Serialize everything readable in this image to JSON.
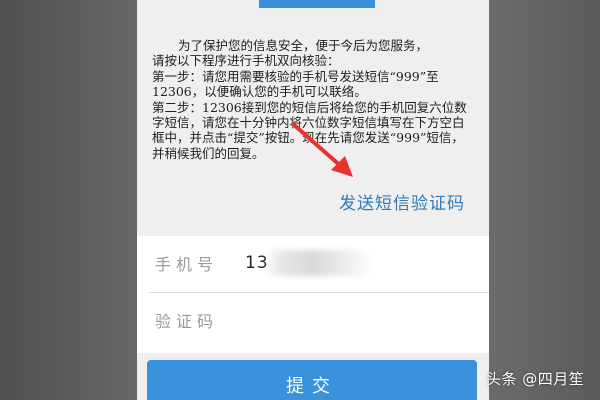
{
  "notice": {
    "lines": [
      "为了保护您的信息安全，便于今后为您服务，",
      "请按以下程序进行手机双向核验：",
      "第一步：请您用需要核验的手机号发送短信“999”至12306，以便确认您的手机可以联络。",
      "第二步：12306接到您的短信后将给您的手机回复六位数字短信，请您在十分钟内将六位数字短信填写在下方空白框中，并点击“提交”按钮。现在先请您发送“999”短信，并稍候我们的回复。"
    ]
  },
  "send_sms_label": "发送短信验证码",
  "form": {
    "phone_label": "手机号",
    "phone_value": "13",
    "code_label": "验证码",
    "code_value": ""
  },
  "submit_label": "提交",
  "watermark": "头条 @四月笙",
  "colors": {
    "accent": "#3a91dc",
    "link": "#2f7ab7",
    "arrow": "#e8322b"
  },
  "icons": {
    "annotation": "red-arrow-icon"
  }
}
